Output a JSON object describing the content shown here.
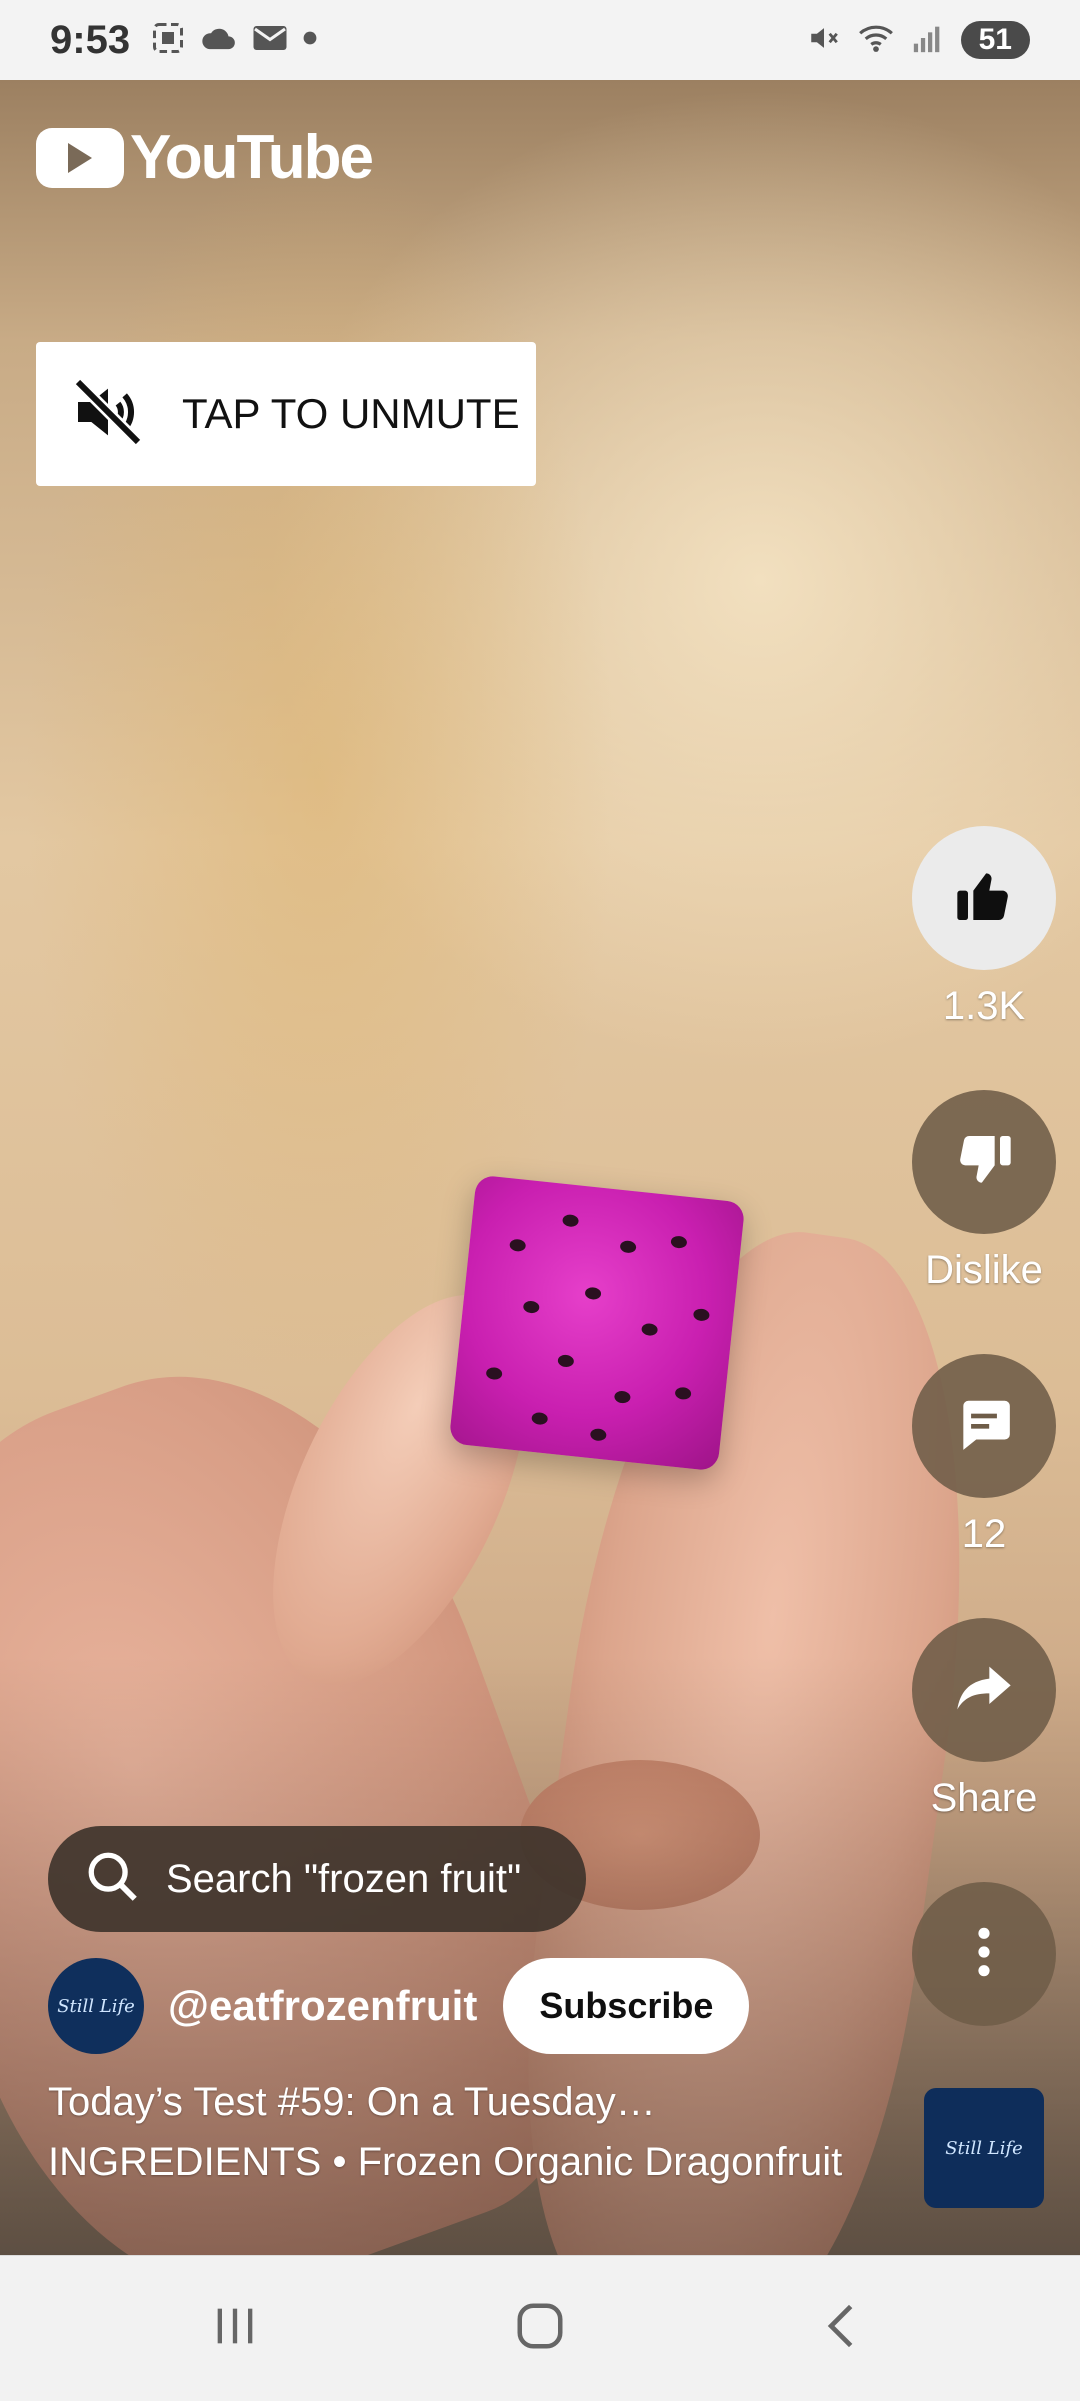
{
  "status_bar": {
    "time": "9:53",
    "battery": "51",
    "icons": [
      "screenshot-icon",
      "cloud-icon",
      "mail-icon",
      "dot-icon",
      "mute-icon",
      "wifi-icon",
      "signal-icon"
    ]
  },
  "app": {
    "logo_text": "YouTube"
  },
  "unmute": {
    "label": "TAP TO UNMUTE"
  },
  "actions": {
    "like_count": "1.3K",
    "dislike_label": "Dislike",
    "comment_count": "12",
    "share_label": "Share"
  },
  "search": {
    "text": "Search \"frozen fruit\""
  },
  "channel": {
    "handle": "@eatfrozenfruit",
    "avatar_text": "Still Life",
    "subscribe_label": "Subscribe"
  },
  "video": {
    "title": "Today’s Test #59: On a Tuesday…",
    "music": "INGREDIENTS • Frozen Organic Dragonfruit",
    "music_thumb_text": "Still Life"
  },
  "colors": {
    "accent_dark_button": "#6e5c48",
    "avatar_navy": "#0f2f5c",
    "fruit_magenta": "#c91fb0"
  }
}
